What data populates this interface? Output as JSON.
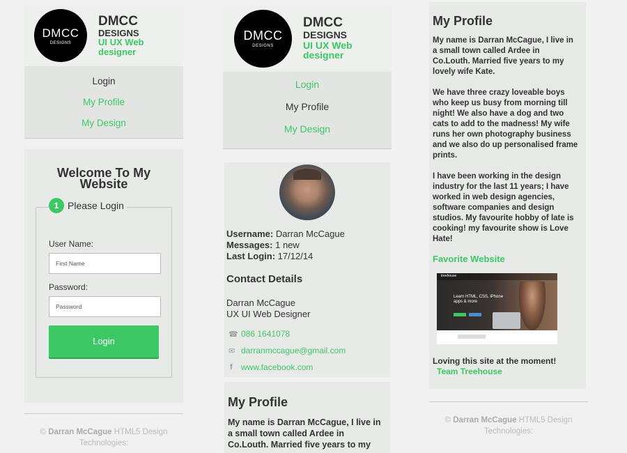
{
  "brand": {
    "logo_text": "DMCC",
    "logo_sub": "DESIGNS",
    "name_line1": "DMCC",
    "name_line2": "DESIGNS",
    "tagline_line1": "UI UX Web",
    "tagline_line2": "designer"
  },
  "nav_left": {
    "items": [
      {
        "label": "Login"
      },
      {
        "label": "My Profile"
      },
      {
        "label": "My Design"
      }
    ]
  },
  "nav_mid": {
    "items": [
      {
        "label": "Login"
      },
      {
        "label": "My Profile"
      },
      {
        "label": "My Design"
      }
    ]
  },
  "login": {
    "heading_line1": "Welcome To My",
    "heading_line2": "Website",
    "step_number": "1",
    "legend": "Please Login",
    "username_label": "User Name:",
    "username_placeholder": "First Name",
    "password_label": "Password:",
    "password_placeholder": "Password",
    "button_label": "Login"
  },
  "profile_card": {
    "username_label": "Username:",
    "username_value": "Darran McCague",
    "messages_label": "Messages:",
    "messages_value": "1 new",
    "last_login_label": "Last Login:",
    "last_login_value": "17/12/14",
    "contact_heading": "Contact Details",
    "contact_name": "Darran McCague",
    "contact_role": "UX UI Web Designer",
    "phone": "086 1641078",
    "email": "darranmccague@gmail.com",
    "facebook": "www.facebook.com"
  },
  "profile_mid": {
    "heading": "My Profile",
    "text_l1": "My name is Darran McCague, I live in",
    "text_l2": "a small town called Ardee in",
    "text_l3": "Co.Louth. Married five years to my"
  },
  "profile_right": {
    "heading": "My Profile",
    "para1": [
      "My name is Darran McCague, I live in",
      "a small town called Ardee in",
      "Co.Louth. Married five years to my",
      "lovely wife Kate."
    ],
    "para2": [
      "We have three crazy loveable boys",
      "who keep us busy from morning till",
      "night! We also have a dog and two",
      "cats to add to the madness! My wife",
      "runs her own photography business",
      "and we also do up personalised frame",
      "prints."
    ],
    "para3": [
      "I have been working in the design",
      "industry for the last 11 years; I have",
      "worked in web design agencies,",
      "software companies and design",
      "studios. My favourite hobby of late is",
      "cooking! my favourite show is Love",
      "Hate!"
    ],
    "favorite_heading": "Favorite Website",
    "screenshot_headline_1": "Learn HTML, CSS, iPhone",
    "screenshot_headline_2": "apps & more",
    "screenshot_logo": "treehouse",
    "caption": "Loving this site at the moment!",
    "caption_link": "Team Treehouse"
  },
  "footer": {
    "copyright": "©",
    "author": "Darran McCague",
    "rest_line1": "HTML5 Design",
    "rest_line2": "Technologies:"
  },
  "colors": {
    "accent": "#3cc865",
    "background": "#f0f1f0",
    "card": "#e8eae8",
    "nav": "#e3e5e3"
  },
  "icons": {
    "phone": "phone-icon",
    "email": "envelope-icon",
    "facebook": "facebook-icon"
  }
}
